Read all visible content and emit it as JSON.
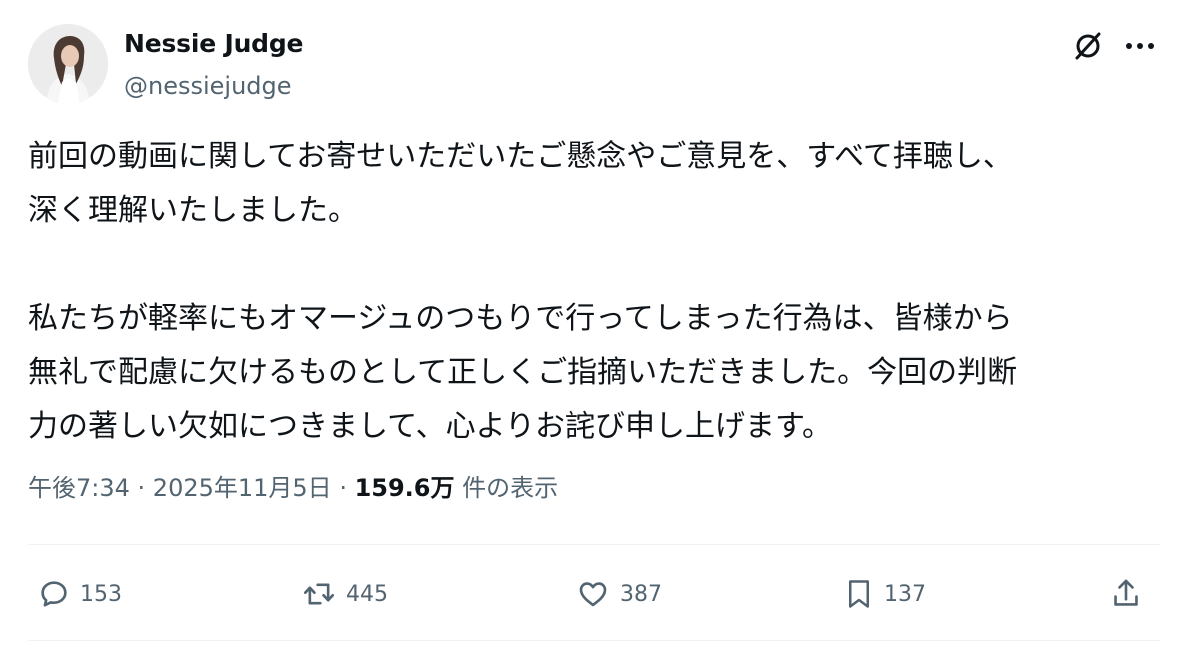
{
  "author": {
    "display_name": "Nessie Judge",
    "handle": "@nessiejudge"
  },
  "icons": {
    "grok": "grok-icon",
    "more": "more-icon",
    "reply": "reply-icon",
    "retweet": "retweet-icon",
    "like": "heart-icon",
    "bookmark": "bookmark-icon",
    "share": "share-icon"
  },
  "tweet": {
    "text": "前回の動画に関してお寄せいただいたご懸念やご意見を、すべて拝聴し、\n深く理解いたしました。\n\n私たちが軽率にもオマージュのつもりで行ってしまった行為は、皆様から\n無礼で配慮に欠けるものとして正しくご指摘いただきました。今回の判断\n力の著しい欠如につきまして、心よりお詫び申し上げます。"
  },
  "meta": {
    "time": "午後7:34",
    "separator1": " · ",
    "date": "2025年11月5日",
    "separator2": " · ",
    "views_count": "159.6万",
    "views_label": " 件の表示"
  },
  "actions": {
    "replies": "153",
    "retweets": "445",
    "likes": "387",
    "bookmarks": "137"
  },
  "colors": {
    "text_primary": "#0f1419",
    "text_secondary": "#536471",
    "divider": "#eff3f4"
  }
}
